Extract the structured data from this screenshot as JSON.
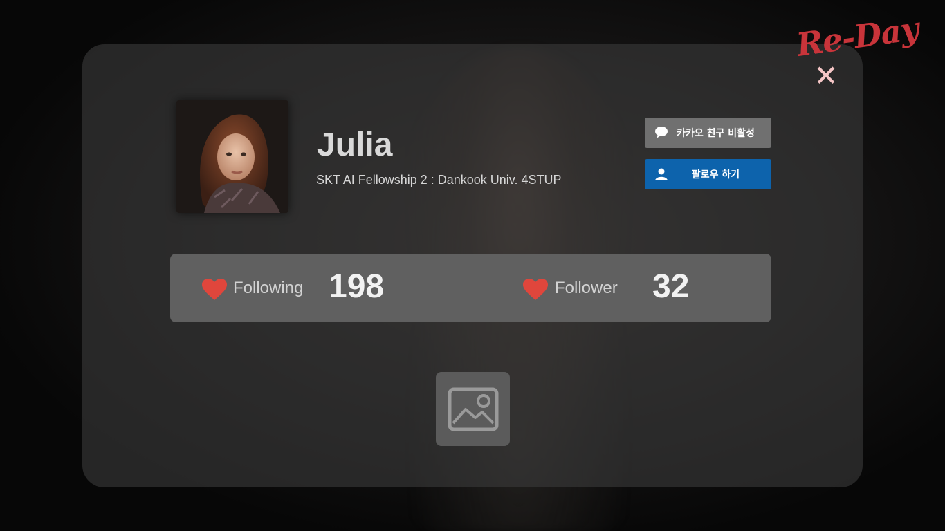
{
  "brand": {
    "logo_text": "Re-Day",
    "accent_color": "#c8343a"
  },
  "profile": {
    "name": "Julia",
    "subtitle": "SKT AI Fellowship 2 : Dankook Univ. 4STUP",
    "avatar": "avatar-photo"
  },
  "actions": {
    "kakao": {
      "icon": "chat-bubble-icon",
      "label": "카카오 친구 비활성",
      "color": "#707070"
    },
    "follow": {
      "icon": "user-icon",
      "label": "팔로우 하기",
      "color": "#0d63ac"
    }
  },
  "stats": {
    "following": {
      "icon": "heart-icon",
      "label": "Following",
      "value": "198"
    },
    "follower": {
      "icon": "heart-icon",
      "label": "Follower",
      "value": "32"
    },
    "heart_color": "#e0463c"
  },
  "close": {
    "icon": "close-icon",
    "glyph": "✕"
  },
  "gallery": {
    "icon": "image-icon"
  }
}
